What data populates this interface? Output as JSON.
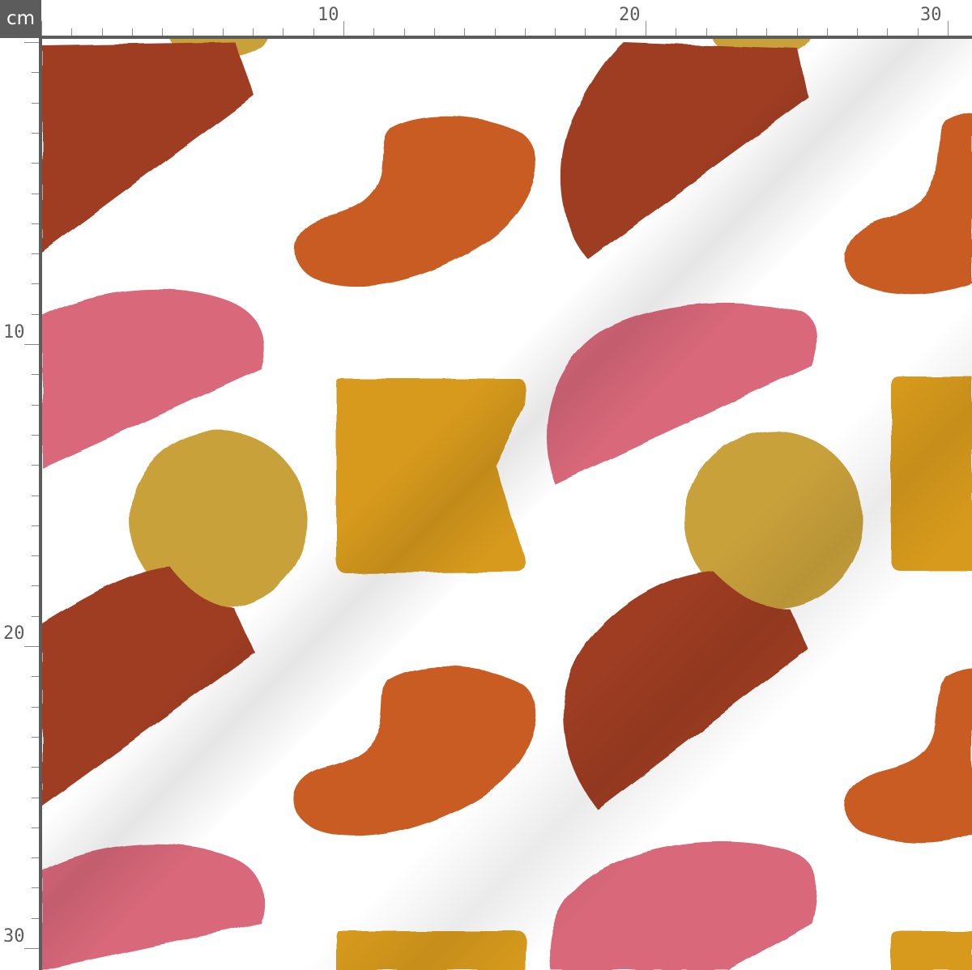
{
  "ruler": {
    "unit": "cm",
    "top_labels": [
      "10",
      "20",
      "30"
    ],
    "left_labels": [
      "10",
      "20",
      "30"
    ]
  },
  "pattern": {
    "description_colors": {
      "rust": "#9e3d22",
      "orange": "#c95b20",
      "pink": "#d8687a",
      "mustard": "#d79a1d",
      "ochre": "#c9a13b"
    },
    "icon": "fabric-swatch"
  }
}
